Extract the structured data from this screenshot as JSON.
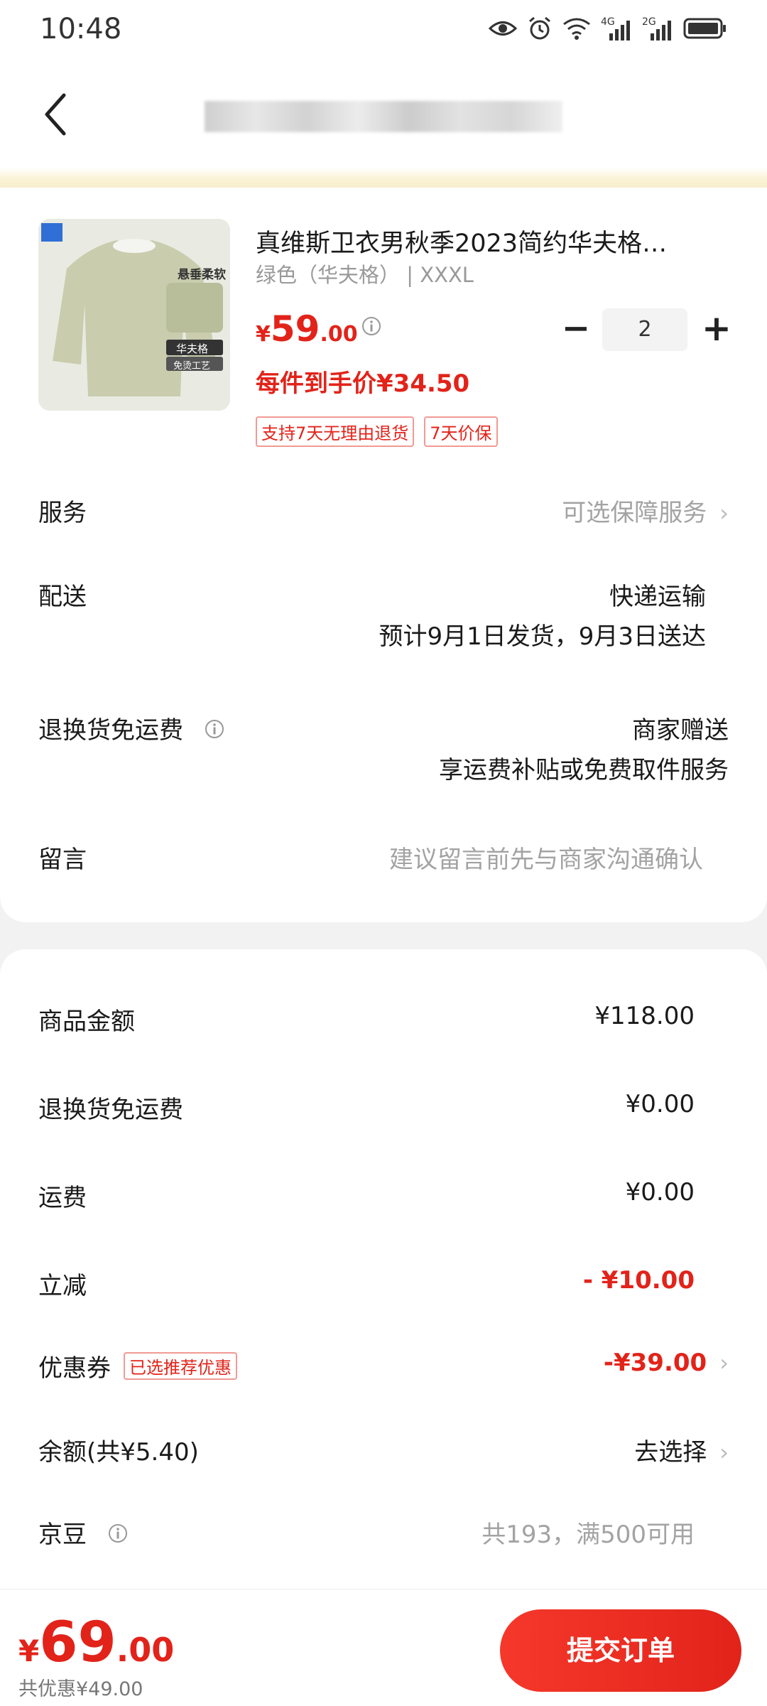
{
  "status_bar": {
    "time": "10:48",
    "network_1": "4G",
    "network_2": "2G"
  },
  "product": {
    "title": "真维斯卫衣男秋季2023简约华夫格…",
    "variant": "绿色（华夫格） | XXXL",
    "price_symbol": "¥",
    "price_integer": "59",
    "price_decimal": ".00",
    "quantity": "2",
    "unit_price": "每件到手价¥34.50",
    "tags": [
      "支持7天无理由退货",
      "7天价保"
    ],
    "thumb_labels": {
      "drape": "悬垂柔软",
      "waffle": "华夫格",
      "craft": "免烫工艺"
    }
  },
  "rows": {
    "service": {
      "label": "服务",
      "value": "可选保障服务"
    },
    "delivery": {
      "label": "配送",
      "value": "快递运输",
      "detail": "预计9月1日发货，9月3日送达"
    },
    "return_shipping": {
      "label": "退换货免运费",
      "value": "商家赠送",
      "detail": "享运费补贴或免费取件服务"
    },
    "message": {
      "label": "留言",
      "placeholder": "建议留言前先与商家沟通确认"
    }
  },
  "summary": {
    "goods_amount": {
      "label": "商品金额",
      "value": "¥118.00"
    },
    "return_fee": {
      "label": "退换货免运费",
      "value": "¥0.00"
    },
    "shipping": {
      "label": "运费",
      "value": "¥0.00"
    },
    "discount": {
      "label": "立减",
      "value": "- ¥10.00"
    },
    "coupon": {
      "label": "优惠券",
      "badge": "已选推荐优惠",
      "value": "-¥39.00"
    },
    "balance": {
      "label": "余额(共¥5.40)",
      "value": "去选择"
    },
    "jd_beans": {
      "label": "京豆",
      "value": "共193，满500可用"
    }
  },
  "bottom": {
    "total_symbol": "¥",
    "total_integer": "69",
    "total_decimal": ".00",
    "saved": "共优惠¥49.00",
    "submit": "提交订单"
  },
  "colors": {
    "accent": "#e2231a",
    "bg": "#f2f2f2"
  }
}
